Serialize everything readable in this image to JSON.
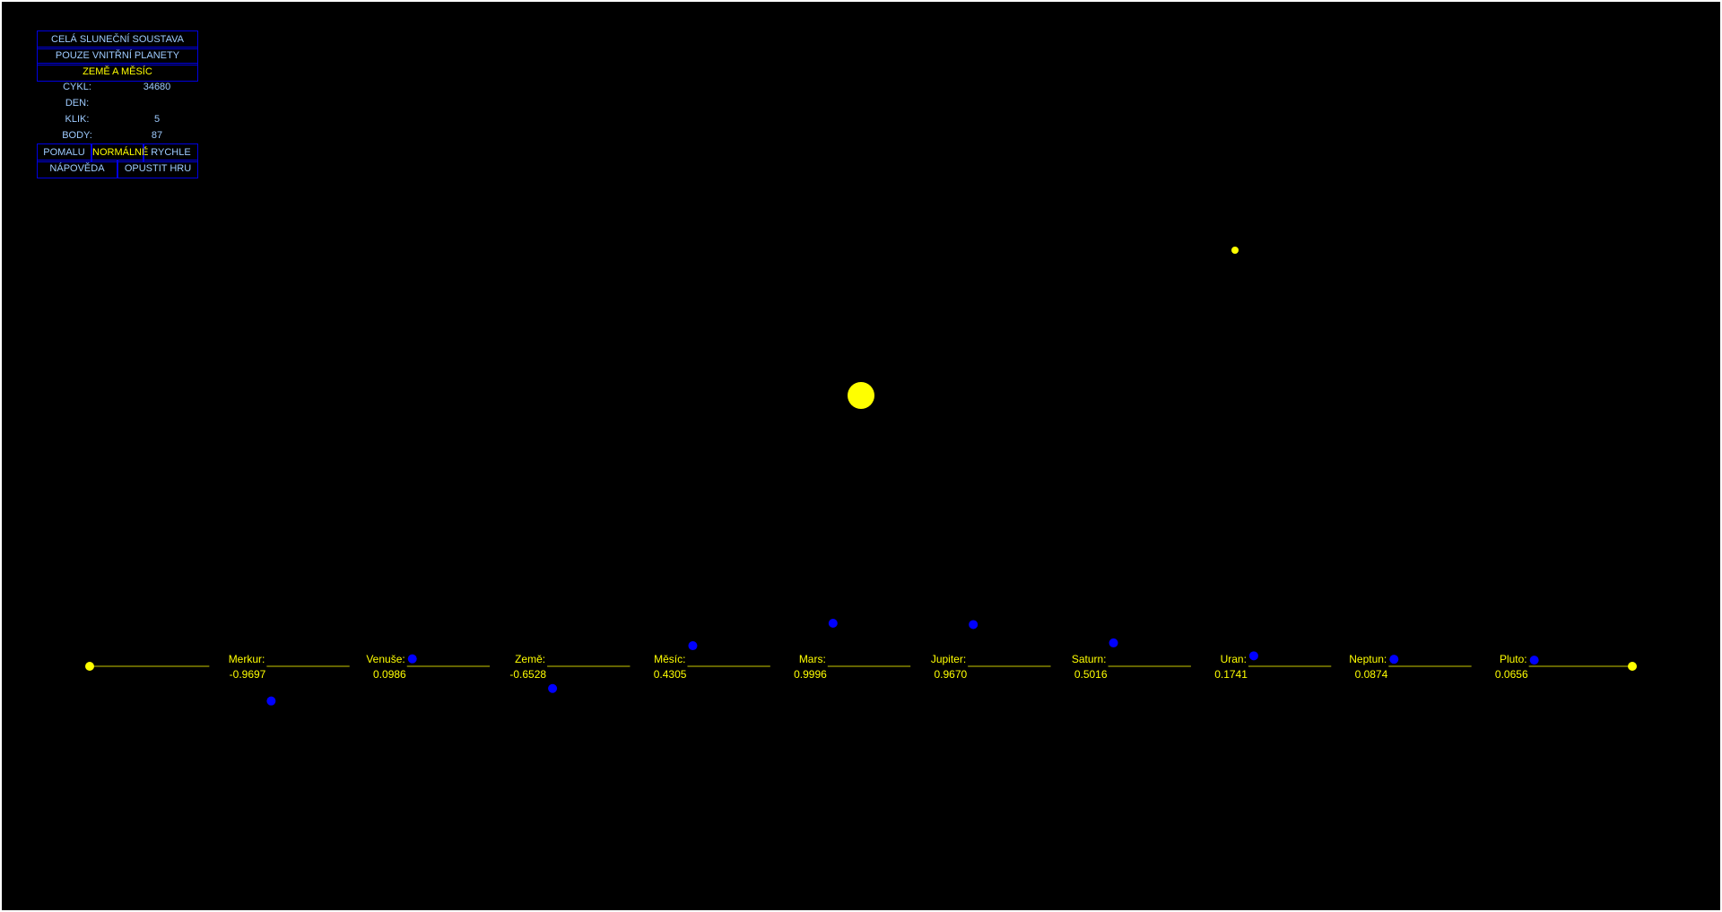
{
  "menu": {
    "whole_system": "CELÁ SLUNEČNÍ SOUSTAVA",
    "inner_planets": "POUZE VNITŘNÍ PLANETY",
    "earth_moon": "ZEMĚ A MĚSÍC"
  },
  "stats": {
    "cycle_label": "CYKL:",
    "cycle_value": "34680",
    "day_label": "DEN:",
    "day_value": "",
    "click_label": "KLIK:",
    "click_value": "5",
    "points_label": "BODY:",
    "points_value": "87"
  },
  "speed": {
    "slow": "POMALU",
    "normal": "NORMÁLNĚ",
    "fast": "RYCHLE"
  },
  "actions": {
    "help": "NÁPOVĚDA",
    "quit": "OPUSTIT HRU"
  },
  "colors": {
    "background": "#000000",
    "border": "#0000e0",
    "text": "#9ecbff",
    "active": "#ffff00",
    "sun": "#ffff00",
    "planet_marker": "#0000ff",
    "track_line": "#c8c800"
  },
  "bodies": [
    {
      "name": "Merkur:",
      "value": "-0.9697"
    },
    {
      "name": "Venuše:",
      "value": "0.0986"
    },
    {
      "name": "Země:",
      "value": "-0.6528"
    },
    {
      "name": "Měsíc:",
      "value": "0.4305"
    },
    {
      "name": "Mars:",
      "value": "0.9996"
    },
    {
      "name": "Jupiter:",
      "value": "0.9670"
    },
    {
      "name": "Saturn:",
      "value": "0.5016"
    },
    {
      "name": "Uran:",
      "value": "0.1741"
    },
    {
      "name": "Neptun:",
      "value": "0.0874"
    },
    {
      "name": "Pluto:",
      "value": "0.0656"
    }
  ]
}
